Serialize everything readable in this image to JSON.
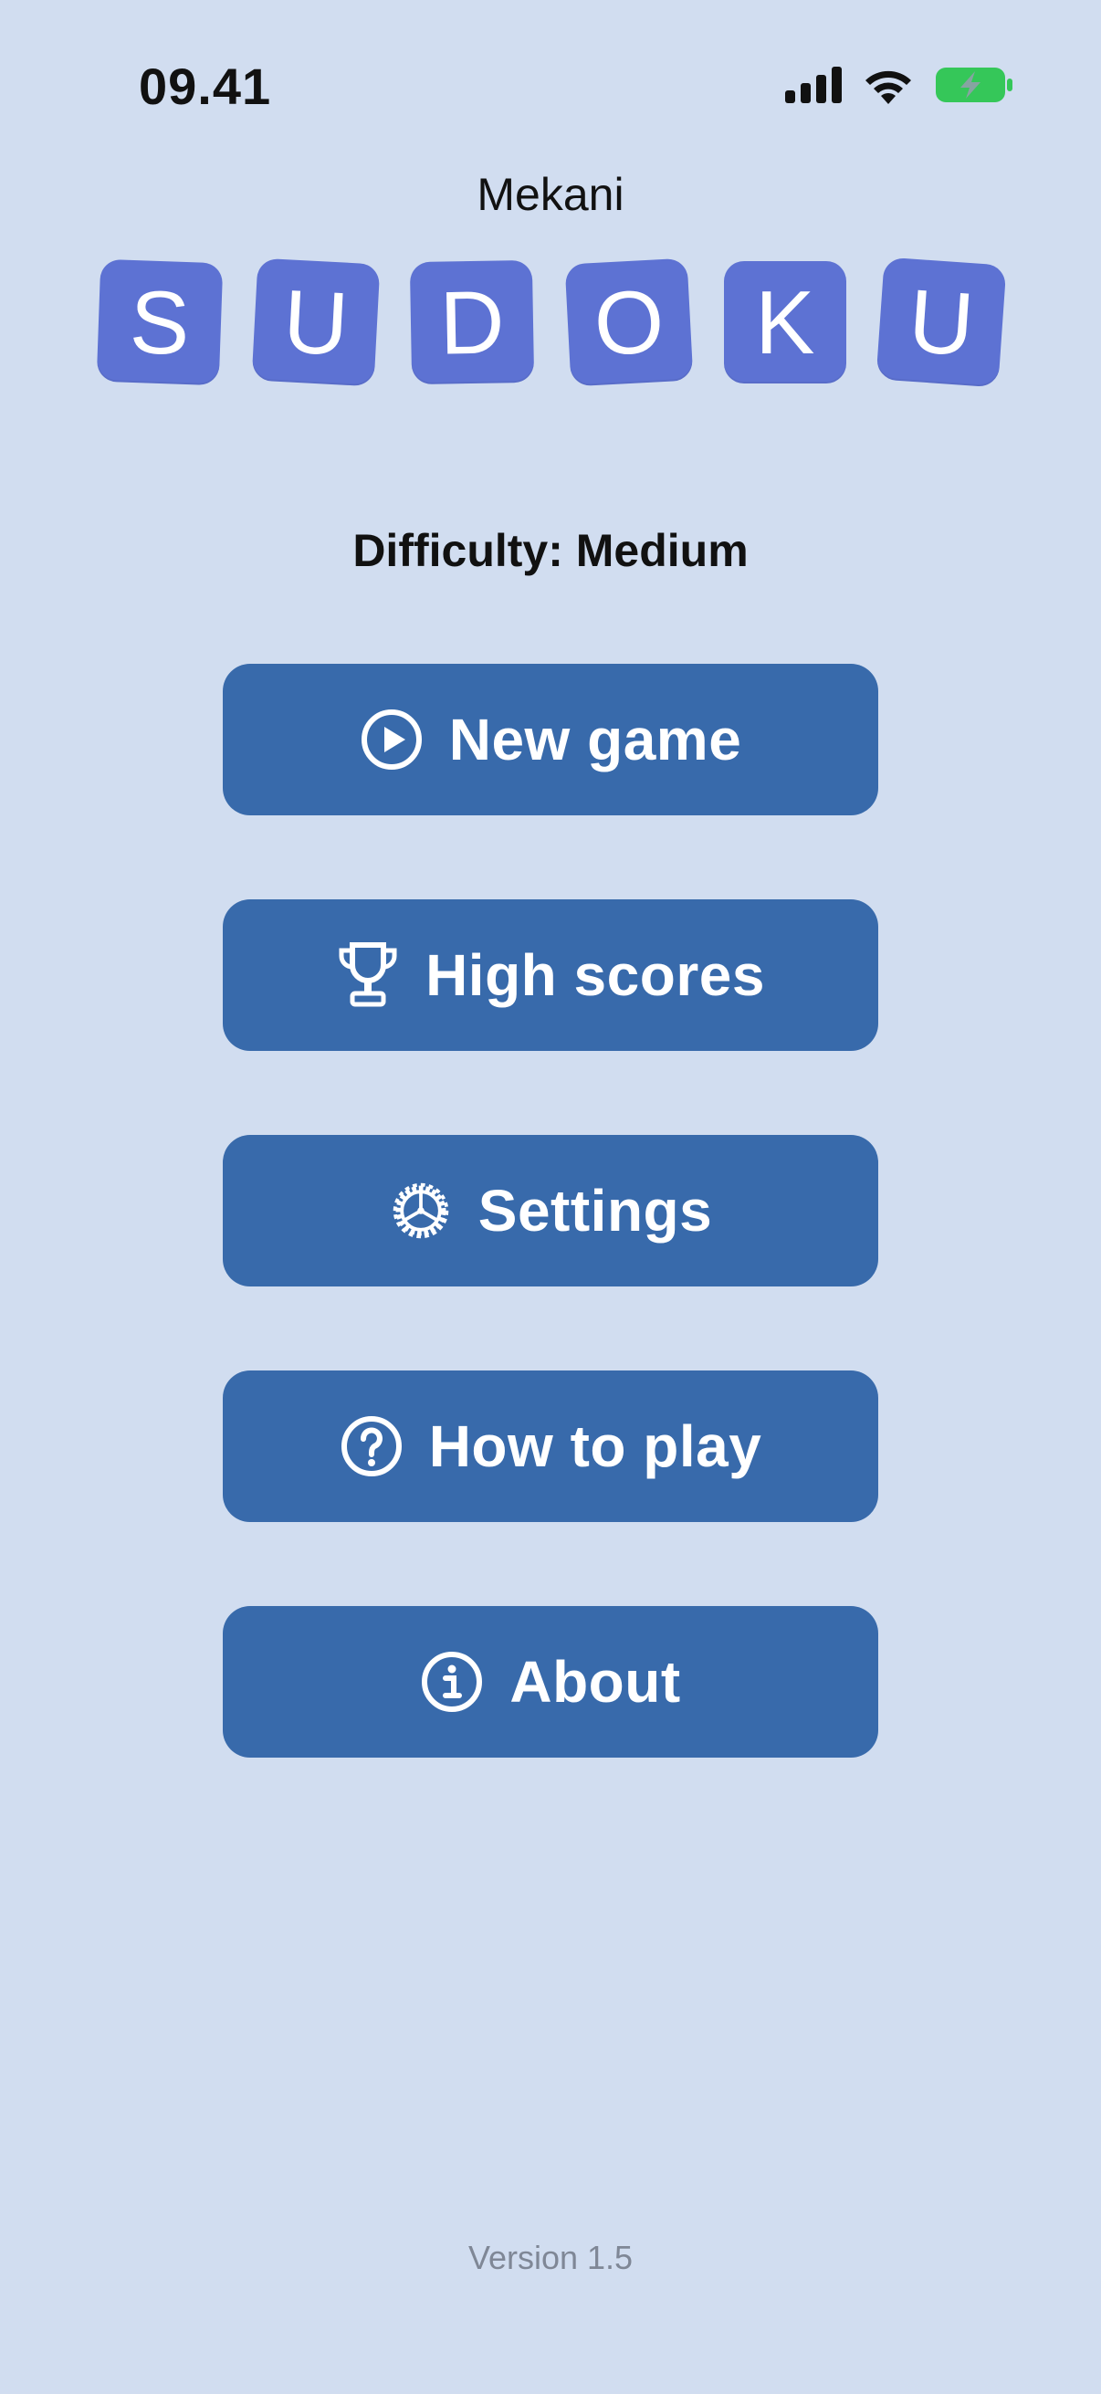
{
  "status_bar": {
    "time": "09.41",
    "icons": [
      "cellular-signal-icon",
      "wifi-icon",
      "battery-charging-icon"
    ],
    "battery_color": "#35c759"
  },
  "header": {
    "brand": "Mekani",
    "logo_letters": [
      "S",
      "U",
      "D",
      "O",
      "K",
      "U"
    ],
    "tile_color": "#5d72d3"
  },
  "difficulty": {
    "text": "Difficulty: Medium"
  },
  "menu": {
    "button_color": "#386aab",
    "items": [
      {
        "label": "New game",
        "icon": "play-circle-icon"
      },
      {
        "label": "High scores",
        "icon": "trophy-icon"
      },
      {
        "label": "Settings",
        "icon": "gear-icon"
      },
      {
        "label": "How to play",
        "icon": "question-circle-icon"
      },
      {
        "label": "About",
        "icon": "info-circle-icon"
      }
    ]
  },
  "footer": {
    "version": "Version 1.5"
  }
}
